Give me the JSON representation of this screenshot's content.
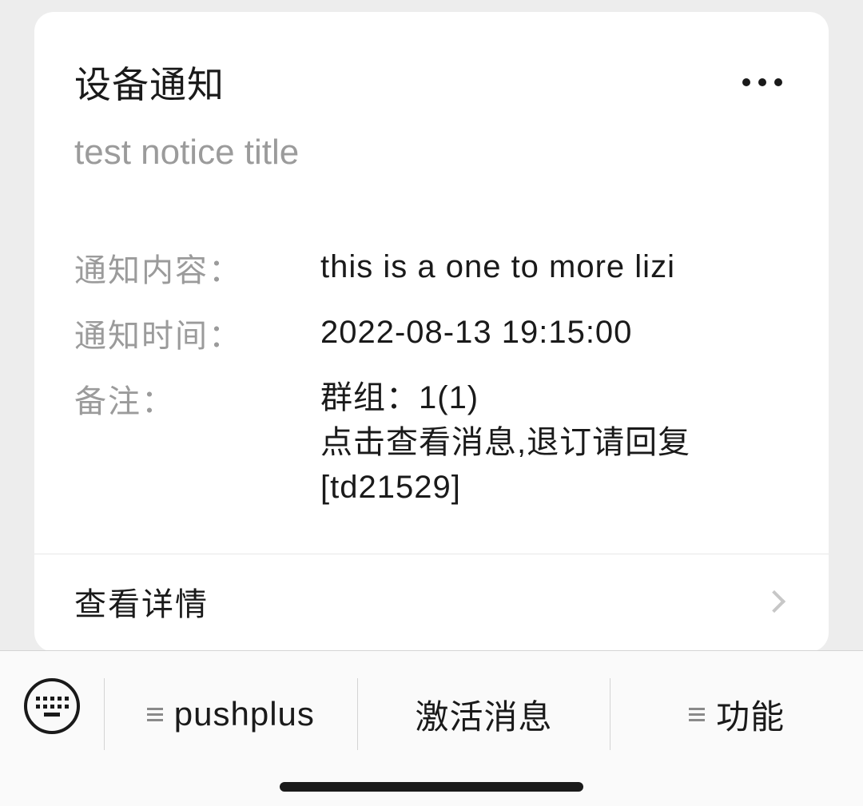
{
  "card": {
    "title": "设备通知",
    "subtitle": "test notice title",
    "rows": [
      {
        "label": "通知内容：",
        "value": "this is a one to more lizi"
      },
      {
        "label": "通知时间：",
        "value": "2022-08-13  19:15:00"
      },
      {
        "label": "备注：",
        "value": "群组：1(1)\n点击查看消息,退订请回复[td21529]"
      }
    ],
    "footer": "查看详情"
  },
  "bottomBar": {
    "tabs": [
      {
        "label": "pushplus",
        "hasMenu": true
      },
      {
        "label": "激活消息",
        "hasMenu": false
      },
      {
        "label": "功能",
        "hasMenu": true
      }
    ]
  }
}
